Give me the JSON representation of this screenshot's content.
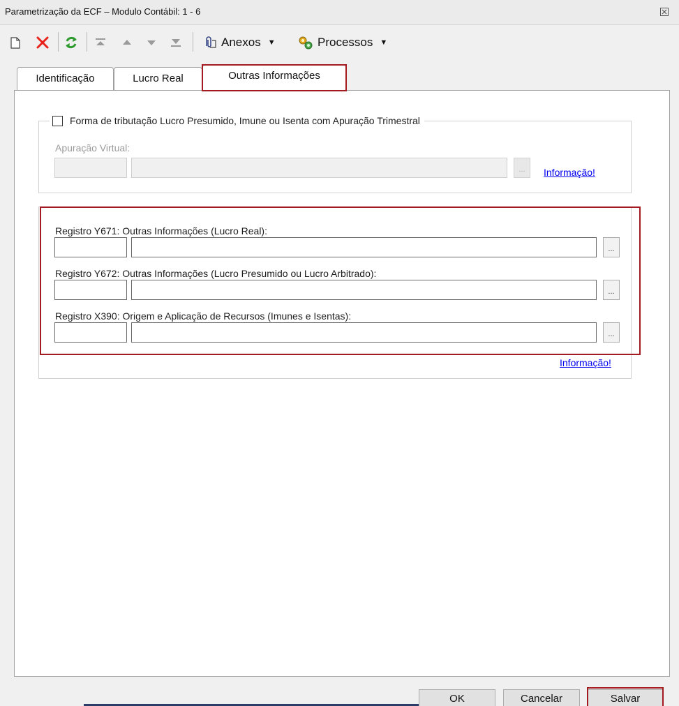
{
  "window": {
    "title": "Parametrização da ECF – Modulo Contábil: 1 - 6"
  },
  "toolbar": {
    "anexos_label": "Anexos",
    "processos_label": "Processos",
    "icons": [
      "new-document-icon",
      "delete-icon",
      "refresh-icon",
      "move-first-icon",
      "move-up-icon",
      "move-down-icon",
      "move-last-icon",
      "paperclip-icon",
      "gear-icon"
    ]
  },
  "tabs": [
    {
      "label": "Identificação",
      "active": false
    },
    {
      "label": "Lucro Real",
      "active": false
    },
    {
      "label": "Outras Informações",
      "active": true
    }
  ],
  "trimestral": {
    "checkbox_label": "Forma de tributação Lucro Presumido, Imune ou Isenta com Apuração Trimestral",
    "checked": false,
    "apuracao_label": "Apuração Virtual:",
    "code_value": "",
    "desc_value": "",
    "lookup_label": "...",
    "info_link": "Informação!"
  },
  "registros": [
    {
      "label": "Registro Y671: Outras Informações (Lucro Real):",
      "code_value": "",
      "desc_value": "",
      "lookup_label": "..."
    },
    {
      "label": "Registro Y672: Outras Informações (Lucro Presumido ou Lucro Arbitrado):",
      "code_value": "",
      "desc_value": "",
      "lookup_label": "..."
    },
    {
      "label": "Registro X390: Origem e Aplicação de Recursos (Imunes e Isentas):",
      "code_value": "",
      "desc_value": "",
      "lookup_label": "..."
    }
  ],
  "registros_info_link": "Informação!",
  "buttons": {
    "ok": "OK",
    "cancel": "Cancelar",
    "save": "Salvar"
  },
  "colors": {
    "highlight": "#a31a20",
    "link": "#0000ee",
    "delete_icon": "#e8221b",
    "refresh_icon": "#2e9b2e"
  }
}
